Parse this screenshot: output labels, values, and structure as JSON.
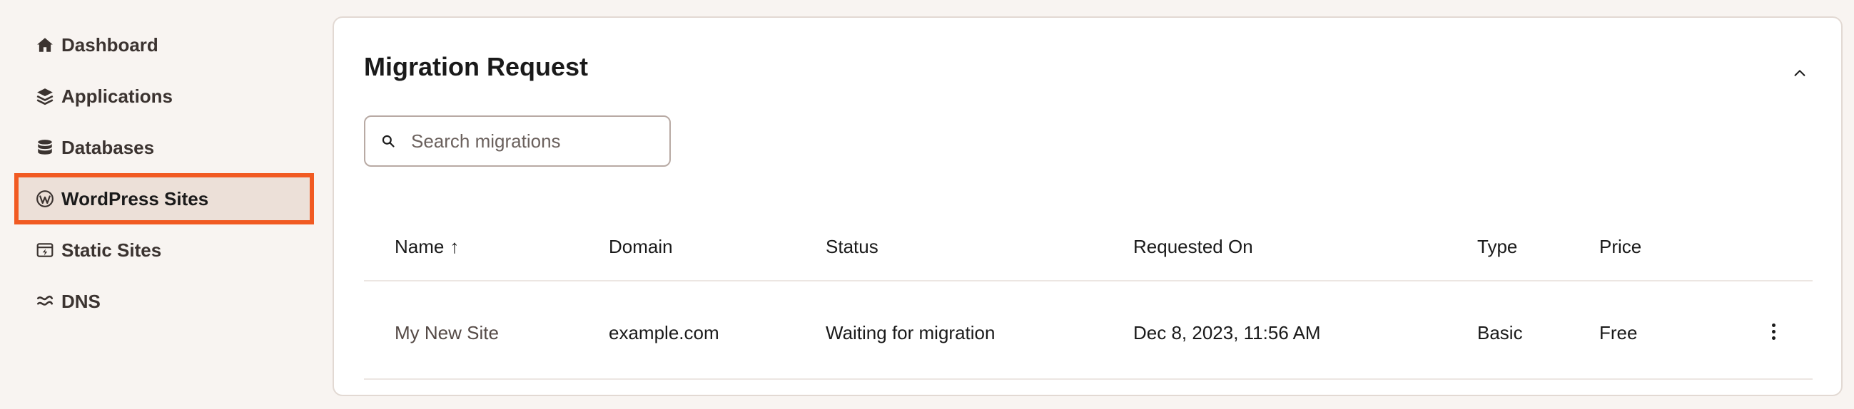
{
  "sidebar": {
    "items": [
      {
        "label": "Dashboard",
        "icon": "home-icon"
      },
      {
        "label": "Applications",
        "icon": "layers-icon"
      },
      {
        "label": "Databases",
        "icon": "database-icon"
      },
      {
        "label": "WordPress Sites",
        "icon": "wordpress-icon",
        "active": true
      },
      {
        "label": "Static Sites",
        "icon": "static-site-icon"
      },
      {
        "label": "DNS",
        "icon": "dns-icon"
      }
    ]
  },
  "card": {
    "title": "Migration Request",
    "search": {
      "placeholder": "Search migrations",
      "value": ""
    },
    "columns": [
      "Name",
      "Domain",
      "Status",
      "Requested On",
      "Type",
      "Price"
    ],
    "sort_indicator": "↑",
    "rows": [
      {
        "name": "My New Site",
        "domain": "example.com",
        "status": "Waiting for migration",
        "requested_on": "Dec 8, 2023, 11:56 AM",
        "type": "Basic",
        "price": "Free"
      }
    ]
  },
  "colors": {
    "accent": "#f15a22",
    "active_bg": "#ece0d8",
    "page_bg": "#f8f4f1"
  }
}
